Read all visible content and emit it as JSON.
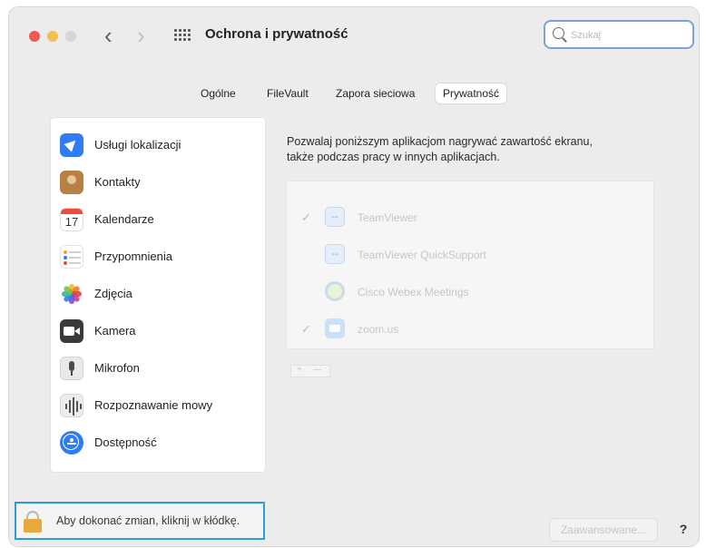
{
  "window": {
    "title": "Ochrona i prywatność"
  },
  "toolbar": {
    "back_glyph": "‹",
    "forward_glyph": "›",
    "grid_icon": "grid-icon",
    "search_placeholder": "Szukaj"
  },
  "tabs": [
    {
      "label": "Ogólne",
      "active": false
    },
    {
      "label": "FileVault",
      "active": false
    },
    {
      "label": "Zapora sieciowa",
      "active": false
    },
    {
      "label": "Prywatność",
      "active": true
    }
  ],
  "sidebar": {
    "items": [
      {
        "label": "Usługi lokalizacji",
        "icon": "location-arrow-icon"
      },
      {
        "label": "Kontakty",
        "icon": "contacts-icon"
      },
      {
        "label": "Kalendarze",
        "icon": "calendar-icon",
        "icon_text": "17",
        "icon_month": "JUL"
      },
      {
        "label": "Przypomnienia",
        "icon": "reminders-icon"
      },
      {
        "label": "Zdjęcia",
        "icon": "photos-icon"
      },
      {
        "label": "Kamera",
        "icon": "camera-icon"
      },
      {
        "label": "Mikrofon",
        "icon": "microphone-icon"
      },
      {
        "label": "Rozpoznawanie mowy",
        "icon": "speech-recognition-icon"
      },
      {
        "label": "Dostępność",
        "icon": "accessibility-icon"
      }
    ]
  },
  "main": {
    "description_line1": "Pozwalaj poniższym aplikacjom nagrywać zawartość ekranu,",
    "description_line2": "także podczas pracy w innych aplikacjach.",
    "apps": [
      {
        "name": "TeamViewer",
        "checked": true,
        "icon": "teamviewer-icon"
      },
      {
        "name": "TeamViewer QuickSupport",
        "checked": false,
        "icon": "teamviewer-icon"
      },
      {
        "name": "Cisco Webex Meetings",
        "checked": false,
        "icon": "webex-icon"
      },
      {
        "name": "zoom.us",
        "checked": true,
        "icon": "zoom-icon"
      }
    ],
    "add_label": "+",
    "remove_label": "—"
  },
  "footer": {
    "lock_text": "Aby dokonać zmian, kliknij w kłódkę.",
    "advanced_label": "Zaawansowane...",
    "help_label": "?"
  },
  "colors": {
    "accent_blue": "#2f7cf6",
    "lock_highlight": "#2c9dd8",
    "traffic_red": "#ee5a52",
    "traffic_yellow": "#f4bd4f"
  }
}
